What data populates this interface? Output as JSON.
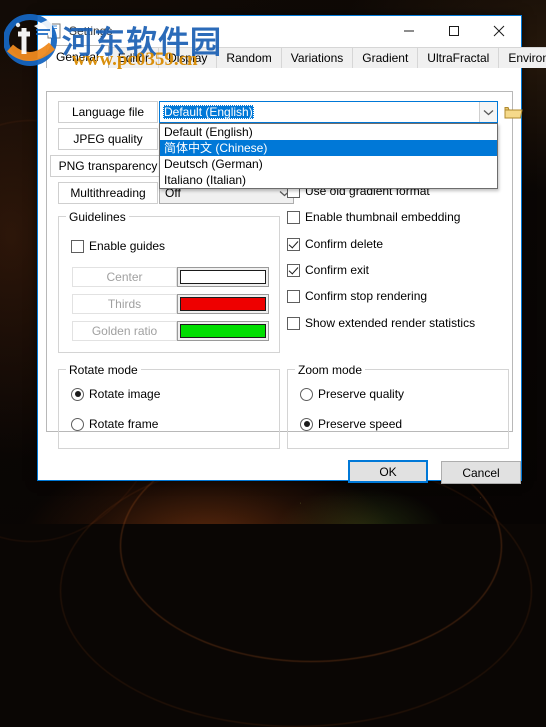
{
  "window": {
    "title": "Settings",
    "icon": "app-icon",
    "minimize_label": "Minimize",
    "maximize_label": "Maximize",
    "close_label": "Close"
  },
  "tabs": [
    {
      "label": "General",
      "active": true
    },
    {
      "label": "Editor",
      "active": false
    },
    {
      "label": "Display",
      "active": false
    },
    {
      "label": "Random",
      "active": false
    },
    {
      "label": "Variations",
      "active": false
    },
    {
      "label": "Gradient",
      "active": false
    },
    {
      "label": "UltraFractal",
      "active": false
    },
    {
      "label": "Environment",
      "active": false
    }
  ],
  "general": {
    "language_file": {
      "label": "Language file",
      "value": "Default (English)",
      "expanded": true,
      "browse_icon": "folder-open-icon",
      "options": [
        {
          "label": "Default (English)",
          "selected": false
        },
        {
          "label": "简体中文 (Chinese)",
          "selected": true
        },
        {
          "label": "Deutsch (German)",
          "selected": false
        },
        {
          "label": "Italiano (Italian)",
          "selected": false
        }
      ]
    },
    "jpeg_quality": {
      "label": "JPEG quality"
    },
    "png_transparency": {
      "label": "PNG transparency"
    },
    "multithreading": {
      "label": "Multithreading",
      "value": "Off"
    },
    "guidelines": {
      "title": "Guidelines",
      "enable": {
        "label": "Enable guides",
        "checked": false
      },
      "rows": [
        {
          "label": "Center",
          "color": "#ffffff",
          "disabled": true
        },
        {
          "label": "Thirds",
          "color": "#ee0000",
          "disabled": true
        },
        {
          "label": "Golden ratio",
          "color": "#00dd00",
          "disabled": true
        }
      ]
    },
    "options": [
      {
        "label": "Use old gradient format",
        "checked": false
      },
      {
        "label": "Enable thumbnail embedding",
        "checked": false
      },
      {
        "label": "Confirm delete",
        "checked": true
      },
      {
        "label": "Confirm exit",
        "checked": true
      },
      {
        "label": "Confirm stop rendering",
        "checked": false
      },
      {
        "label": "Show extended render statistics",
        "checked": false
      }
    ],
    "rotate_mode": {
      "title": "Rotate mode",
      "options": [
        {
          "label": "Rotate image",
          "selected": true
        },
        {
          "label": "Rotate frame",
          "selected": false
        }
      ]
    },
    "zoom_mode": {
      "title": "Zoom mode",
      "options": [
        {
          "label": "Preserve quality",
          "selected": false
        },
        {
          "label": "Preserve speed",
          "selected": true
        }
      ]
    }
  },
  "footer": {
    "ok_label": "OK",
    "cancel_label": "Cancel"
  },
  "watermark": {
    "site_name": "河东软件园",
    "site_url": "www.pc0359.cn"
  },
  "colors": {
    "accent": "#0078d7",
    "guide_center": "#ffffff",
    "guide_thirds": "#ee0000",
    "guide_golden": "#00dd00",
    "watermark_blue": "#1a5fb4",
    "watermark_orange": "#d88a00"
  }
}
